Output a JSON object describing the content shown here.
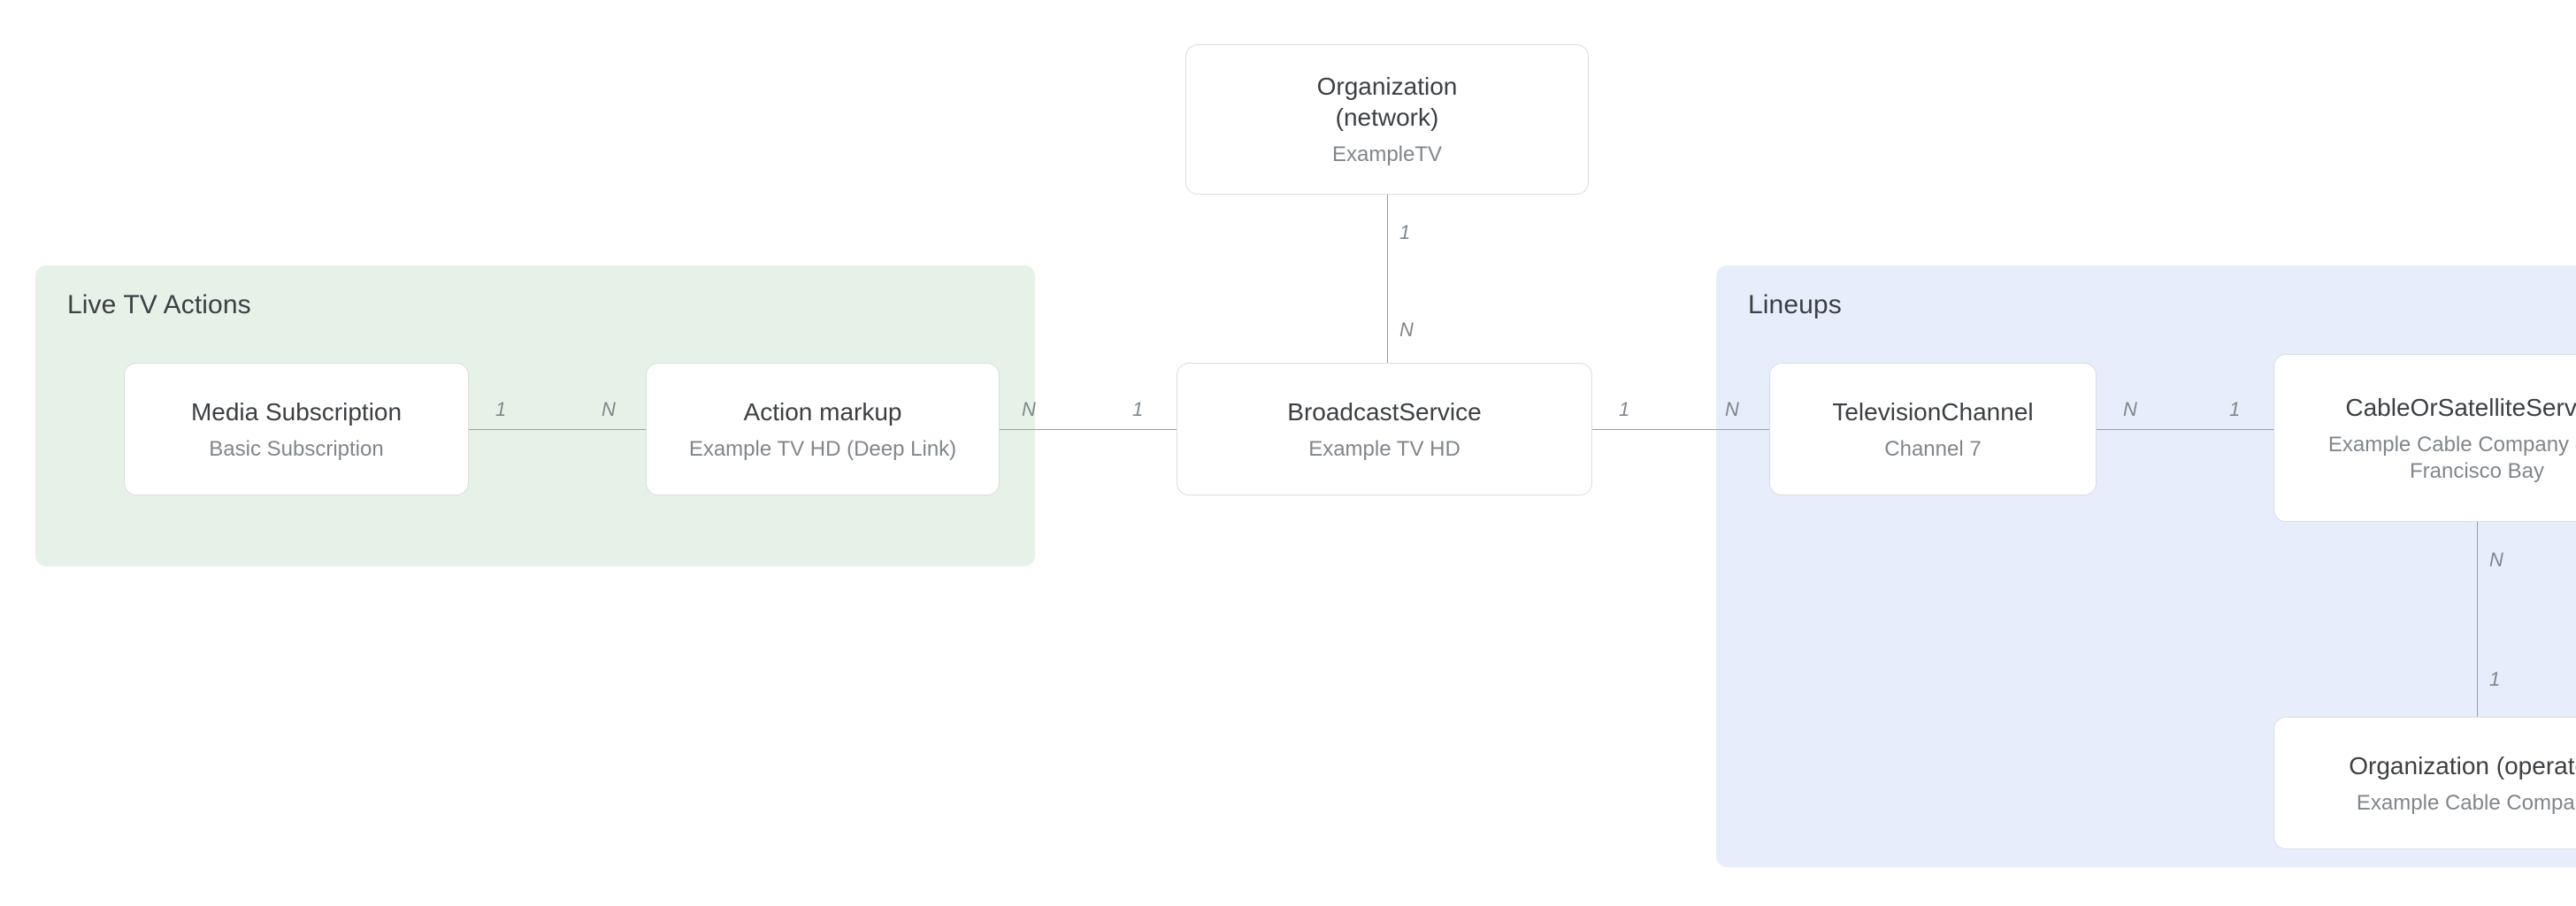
{
  "groups": {
    "liveTvActions": {
      "title": "Live TV Actions"
    },
    "lineups": {
      "title": "Lineups"
    }
  },
  "nodes": {
    "organizationNetwork": {
      "title": "Organization\n(network)",
      "sub": "ExampleTV"
    },
    "mediaSubscription": {
      "title": "Media Subscription",
      "sub": "Basic Subscription"
    },
    "actionMarkup": {
      "title": "Action markup",
      "sub": "Example TV HD (Deep Link)"
    },
    "broadcastService": {
      "title": "BroadcastService",
      "sub": "Example TV HD"
    },
    "televisionChannel": {
      "title": "TelevisionChannel",
      "sub": "Channel 7"
    },
    "cableOrSatelliteService": {
      "title": "CableOrSatelliteService",
      "sub": "Example Cable Company - San Francisco Bay"
    },
    "organizationOperator": {
      "title": "Organization (operator)",
      "sub": "Example Cable Company"
    }
  },
  "cardinalities": {
    "orgNet_to_bs_top": "1",
    "orgNet_to_bs_bottom": "N",
    "ms_to_am_left": "1",
    "ms_to_am_right": "N",
    "am_to_bs_left": "N",
    "am_to_bs_right": "1",
    "bs_to_tc_left": "1",
    "bs_to_tc_right": "N",
    "tc_to_css_left": "N",
    "tc_to_css_right": "1",
    "css_to_op_top": "N",
    "css_to_op_bottom": "1"
  }
}
